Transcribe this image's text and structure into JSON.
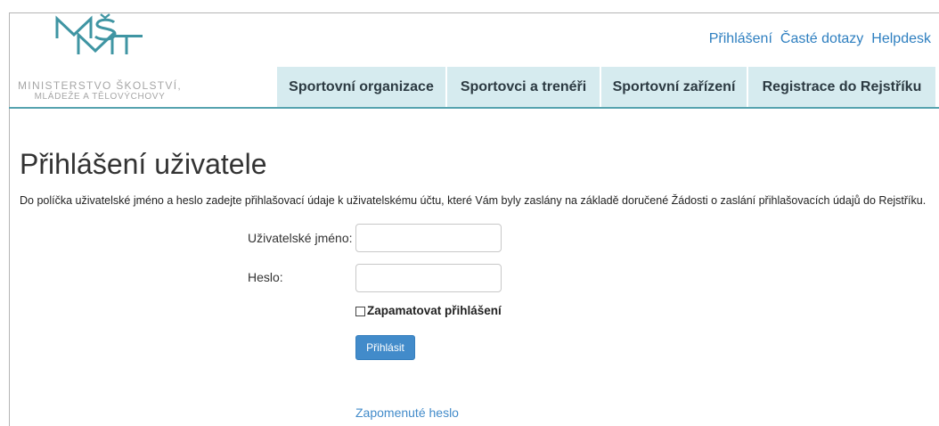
{
  "header": {
    "logo": {
      "lettering": "MŠMT",
      "icon": "msmt-logo"
    },
    "ministry_line1": "MINISTERSTVO ŠKOLSTVÍ,",
    "ministry_line2": "MLÁDEŽE A TĚLOVÝCHOVY",
    "top_links": [
      "Přihlášení",
      "Časté dotazy",
      "Helpdesk"
    ]
  },
  "nav": {
    "tabs": [
      "Sportovní organizace",
      "Sportovci a trenéři",
      "Sportovní zařízení",
      "Registrace do Rejstříku"
    ]
  },
  "main": {
    "title": "Přihlášení uživatele",
    "intro": "Do políčka uživatelské jméno a heslo zadejte přihlašovací údaje k uživatelskému účtu, které Vám byly zaslány na základě doručené Žádosti o zaslání přihlašovacích údajů do Rejstříku.",
    "form": {
      "username_label": "Uživatelské jméno:",
      "username_value": "",
      "password_label": "Heslo:",
      "password_value": "",
      "remember_label": "Zapamatovat přihlášení",
      "remember_checked": false,
      "submit_label": "Přihlásit",
      "forgot_password_link": "Zapomenuté heslo"
    }
  },
  "theme": {
    "brand_teal": "#3f95a3",
    "accent_line": "#56a3af",
    "nav_background": "#d6ebef",
    "link_blue": "#2e7fc0",
    "button_blue": "#428bca"
  }
}
